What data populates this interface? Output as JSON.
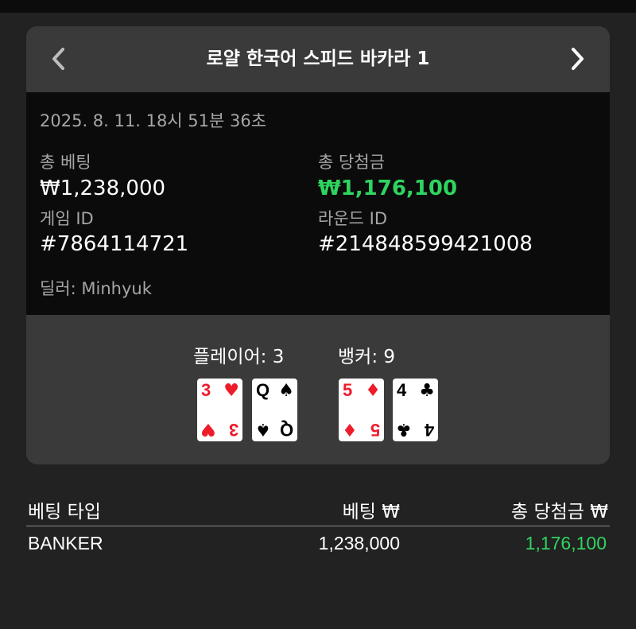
{
  "header": {
    "title": "로얄 한국어 스피드 바카라 1",
    "prev_icon": "chevron-left-icon",
    "next_icon": "chevron-right-icon"
  },
  "info": {
    "datetime": "2025. 8. 11. 18시 51분 36초",
    "total_bet_label": "총 베팅",
    "total_bet_value": "₩1,238,000",
    "total_win_label": "총 당첨금",
    "total_win_value": "₩1,176,100",
    "game_id_label": "게임 ID",
    "game_id_value": "#7864114721",
    "round_id_label": "라운드 ID",
    "round_id_value": "#214848599421008",
    "dealer": "딜러: Minhyuk"
  },
  "hands": {
    "player_label": "플레이어: 3",
    "banker_label": "뱅커: 9",
    "player_cards": [
      {
        "rank": "3",
        "suit": "♥",
        "color": "red"
      },
      {
        "rank": "Q",
        "suit": "♠",
        "color": "black"
      }
    ],
    "banker_cards": [
      {
        "rank": "5",
        "suit": "♦",
        "color": "red"
      },
      {
        "rank": "4",
        "suit": "♣",
        "color": "black"
      }
    ]
  },
  "table": {
    "headers": [
      "베팅 타입",
      "베팅 ₩",
      "총 당첨금 ₩"
    ],
    "rows": [
      {
        "type": "BANKER",
        "bet": "1,238,000",
        "win": "1,176,100"
      }
    ]
  },
  "colors": {
    "win_green": "#2fd35f",
    "card_red": "#ee1c2b",
    "panel": "#3a3a3a",
    "info_bg": "#0b0b0b",
    "page_bg": "#222222"
  }
}
